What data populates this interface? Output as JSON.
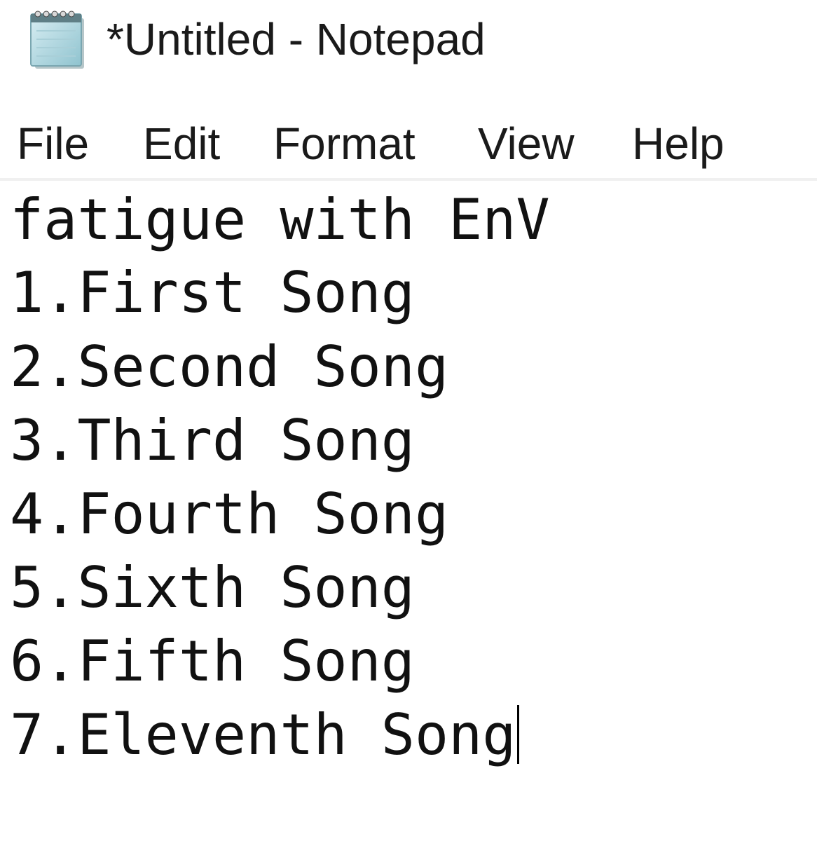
{
  "window": {
    "title": "*Untitled - Notepad",
    "icon": "notepad-icon"
  },
  "menu": {
    "items": [
      {
        "label": "File"
      },
      {
        "label": "Edit"
      },
      {
        "label": "Format"
      },
      {
        "label": "View"
      },
      {
        "label": "Help"
      }
    ]
  },
  "editor": {
    "lines": [
      "fatigue with EnV",
      "1.First Song",
      "2.Second Song",
      "3.Third Song",
      "4.Fourth Song",
      "5.Sixth Song",
      "6.Fifth Song",
      "7.Eleventh Song"
    ]
  }
}
